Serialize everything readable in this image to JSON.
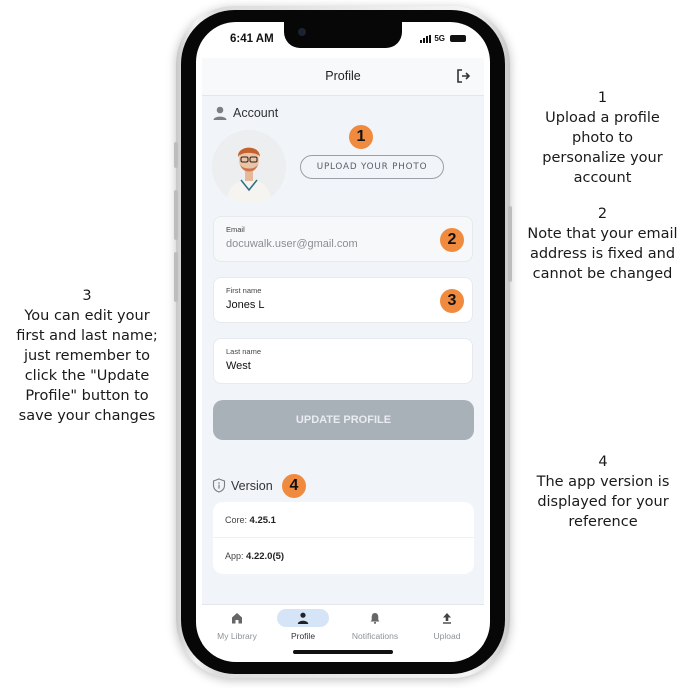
{
  "annotations": [
    {
      "number": "1",
      "text": "Upload a profile photo to personalize your account"
    },
    {
      "number": "2",
      "text": "Note that your email address is fixed and cannot be changed"
    },
    {
      "number": "3",
      "text": "You can edit your first and last name; just remember to click the \"Update Profile\" button to save your changes"
    },
    {
      "number": "4",
      "text": "The app version is displayed for your reference"
    }
  ],
  "status_bar": {
    "time": "6:41 AM",
    "network": "5G"
  },
  "header": {
    "title": "Profile",
    "logout_icon": "logout-icon"
  },
  "account": {
    "section_label": "Account",
    "upload_button": "UPLOAD YOUR PHOTO",
    "email": {
      "label": "Email",
      "value": "docuwalk.user@gmail.com"
    },
    "first_name": {
      "label": "First name",
      "value": "Jones L"
    },
    "last_name": {
      "label": "Last name",
      "value": "West"
    },
    "update_button": "UPDATE PROFILE"
  },
  "version": {
    "section_label": "Version",
    "core_label": "Core:",
    "core_value": "4.25.1",
    "app_label": "App:",
    "app_value": "4.22.0(5)"
  },
  "badges": [
    "1",
    "2",
    "3",
    "4"
  ],
  "tabs": [
    {
      "label": "My Library",
      "icon": "home-icon",
      "active": false
    },
    {
      "label": "Profile",
      "icon": "person-icon",
      "active": true
    },
    {
      "label": "Notifications",
      "icon": "bell-icon",
      "active": false
    },
    {
      "label": "Upload",
      "icon": "upload-icon",
      "active": false
    }
  ],
  "colors": {
    "badge": "#f08a3e",
    "active_tab_bg": "#d6e4f7",
    "update_button": "#a8b0b8",
    "app_bg": "#f1f4f9"
  }
}
